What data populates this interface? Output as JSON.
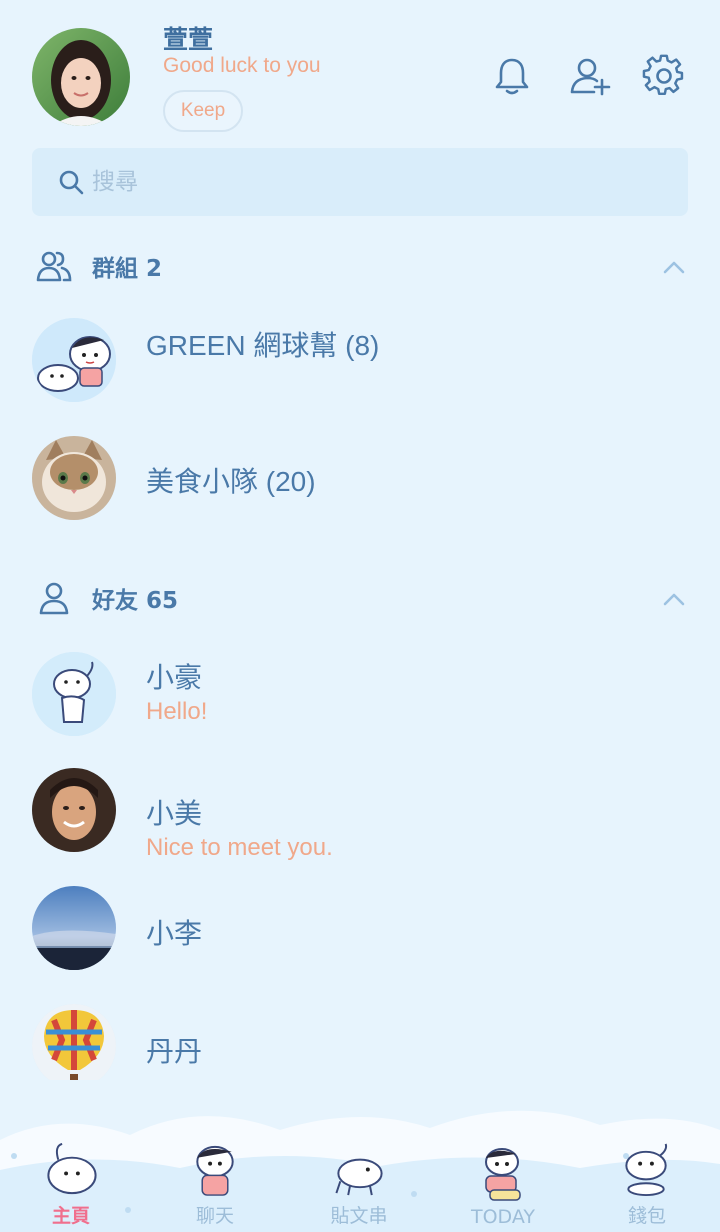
{
  "profile": {
    "name": "萱萱",
    "status": "Good luck to you",
    "keep_label": "Keep"
  },
  "header_icons": [
    "bell-icon",
    "add-friend-icon",
    "gear-icon"
  ],
  "search": {
    "placeholder": "搜尋",
    "value": ""
  },
  "groups_section": {
    "title": "群組 2",
    "items": [
      {
        "name": "GREEN 網球幫 (8)",
        "avatar": "cartoon-boy-dog"
      },
      {
        "name": "美食小隊 (20)",
        "avatar": "cat-photo"
      }
    ]
  },
  "friends_section": {
    "title": "好友 65",
    "items": [
      {
        "name": "小豪",
        "message": "Hello!",
        "avatar": "cartoon-dog"
      },
      {
        "name": "小美",
        "message": "Nice to meet you.",
        "avatar": "woman-photo"
      },
      {
        "name": "小李",
        "message": "",
        "avatar": "sky-photo"
      },
      {
        "name": "丹丹",
        "message": "",
        "avatar": "balloon-photo"
      }
    ]
  },
  "bottom_nav": {
    "items": [
      {
        "label": "主頁",
        "active": true
      },
      {
        "label": "聊天",
        "active": false
      },
      {
        "label": "貼文串",
        "active": false
      },
      {
        "label": "TODAY",
        "active": false
      },
      {
        "label": "錢包",
        "active": false
      }
    ]
  },
  "colors": {
    "background": "#e7f4fd",
    "primary_text": "#4a79a8",
    "accent_orange": "#f0a88a",
    "active_nav": "#f06f8d"
  }
}
